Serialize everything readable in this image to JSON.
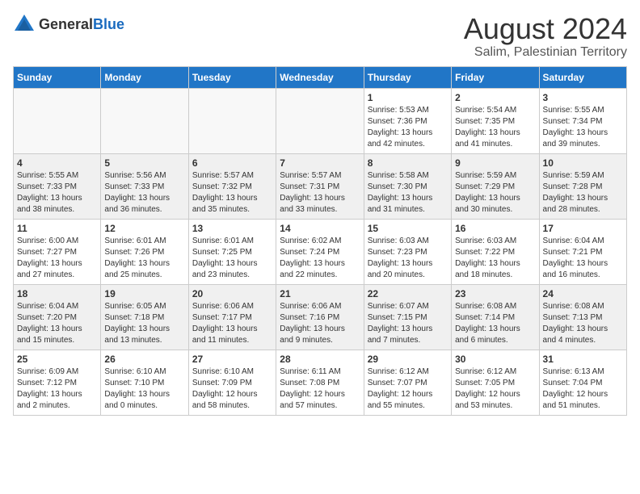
{
  "logo": {
    "general": "General",
    "blue": "Blue"
  },
  "title": "August 2024",
  "subtitle": "Salim, Palestinian Territory",
  "headers": [
    "Sunday",
    "Monday",
    "Tuesday",
    "Wednesday",
    "Thursday",
    "Friday",
    "Saturday"
  ],
  "weeks": [
    [
      {
        "day": "",
        "info": ""
      },
      {
        "day": "",
        "info": ""
      },
      {
        "day": "",
        "info": ""
      },
      {
        "day": "",
        "info": ""
      },
      {
        "day": "1",
        "info": "Sunrise: 5:53 AM\nSunset: 7:36 PM\nDaylight: 13 hours\nand 42 minutes."
      },
      {
        "day": "2",
        "info": "Sunrise: 5:54 AM\nSunset: 7:35 PM\nDaylight: 13 hours\nand 41 minutes."
      },
      {
        "day": "3",
        "info": "Sunrise: 5:55 AM\nSunset: 7:34 PM\nDaylight: 13 hours\nand 39 minutes."
      }
    ],
    [
      {
        "day": "4",
        "info": "Sunrise: 5:55 AM\nSunset: 7:33 PM\nDaylight: 13 hours\nand 38 minutes."
      },
      {
        "day": "5",
        "info": "Sunrise: 5:56 AM\nSunset: 7:33 PM\nDaylight: 13 hours\nand 36 minutes."
      },
      {
        "day": "6",
        "info": "Sunrise: 5:57 AM\nSunset: 7:32 PM\nDaylight: 13 hours\nand 35 minutes."
      },
      {
        "day": "7",
        "info": "Sunrise: 5:57 AM\nSunset: 7:31 PM\nDaylight: 13 hours\nand 33 minutes."
      },
      {
        "day": "8",
        "info": "Sunrise: 5:58 AM\nSunset: 7:30 PM\nDaylight: 13 hours\nand 31 minutes."
      },
      {
        "day": "9",
        "info": "Sunrise: 5:59 AM\nSunset: 7:29 PM\nDaylight: 13 hours\nand 30 minutes."
      },
      {
        "day": "10",
        "info": "Sunrise: 5:59 AM\nSunset: 7:28 PM\nDaylight: 13 hours\nand 28 minutes."
      }
    ],
    [
      {
        "day": "11",
        "info": "Sunrise: 6:00 AM\nSunset: 7:27 PM\nDaylight: 13 hours\nand 27 minutes."
      },
      {
        "day": "12",
        "info": "Sunrise: 6:01 AM\nSunset: 7:26 PM\nDaylight: 13 hours\nand 25 minutes."
      },
      {
        "day": "13",
        "info": "Sunrise: 6:01 AM\nSunset: 7:25 PM\nDaylight: 13 hours\nand 23 minutes."
      },
      {
        "day": "14",
        "info": "Sunrise: 6:02 AM\nSunset: 7:24 PM\nDaylight: 13 hours\nand 22 minutes."
      },
      {
        "day": "15",
        "info": "Sunrise: 6:03 AM\nSunset: 7:23 PM\nDaylight: 13 hours\nand 20 minutes."
      },
      {
        "day": "16",
        "info": "Sunrise: 6:03 AM\nSunset: 7:22 PM\nDaylight: 13 hours\nand 18 minutes."
      },
      {
        "day": "17",
        "info": "Sunrise: 6:04 AM\nSunset: 7:21 PM\nDaylight: 13 hours\nand 16 minutes."
      }
    ],
    [
      {
        "day": "18",
        "info": "Sunrise: 6:04 AM\nSunset: 7:20 PM\nDaylight: 13 hours\nand 15 minutes."
      },
      {
        "day": "19",
        "info": "Sunrise: 6:05 AM\nSunset: 7:18 PM\nDaylight: 13 hours\nand 13 minutes."
      },
      {
        "day": "20",
        "info": "Sunrise: 6:06 AM\nSunset: 7:17 PM\nDaylight: 13 hours\nand 11 minutes."
      },
      {
        "day": "21",
        "info": "Sunrise: 6:06 AM\nSunset: 7:16 PM\nDaylight: 13 hours\nand 9 minutes."
      },
      {
        "day": "22",
        "info": "Sunrise: 6:07 AM\nSunset: 7:15 PM\nDaylight: 13 hours\nand 7 minutes."
      },
      {
        "day": "23",
        "info": "Sunrise: 6:08 AM\nSunset: 7:14 PM\nDaylight: 13 hours\nand 6 minutes."
      },
      {
        "day": "24",
        "info": "Sunrise: 6:08 AM\nSunset: 7:13 PM\nDaylight: 13 hours\nand 4 minutes."
      }
    ],
    [
      {
        "day": "25",
        "info": "Sunrise: 6:09 AM\nSunset: 7:12 PM\nDaylight: 13 hours\nand 2 minutes."
      },
      {
        "day": "26",
        "info": "Sunrise: 6:10 AM\nSunset: 7:10 PM\nDaylight: 13 hours\nand 0 minutes."
      },
      {
        "day": "27",
        "info": "Sunrise: 6:10 AM\nSunset: 7:09 PM\nDaylight: 12 hours\nand 58 minutes."
      },
      {
        "day": "28",
        "info": "Sunrise: 6:11 AM\nSunset: 7:08 PM\nDaylight: 12 hours\nand 57 minutes."
      },
      {
        "day": "29",
        "info": "Sunrise: 6:12 AM\nSunset: 7:07 PM\nDaylight: 12 hours\nand 55 minutes."
      },
      {
        "day": "30",
        "info": "Sunrise: 6:12 AM\nSunset: 7:05 PM\nDaylight: 12 hours\nand 53 minutes."
      },
      {
        "day": "31",
        "info": "Sunrise: 6:13 AM\nSunset: 7:04 PM\nDaylight: 12 hours\nand 51 minutes."
      }
    ]
  ]
}
